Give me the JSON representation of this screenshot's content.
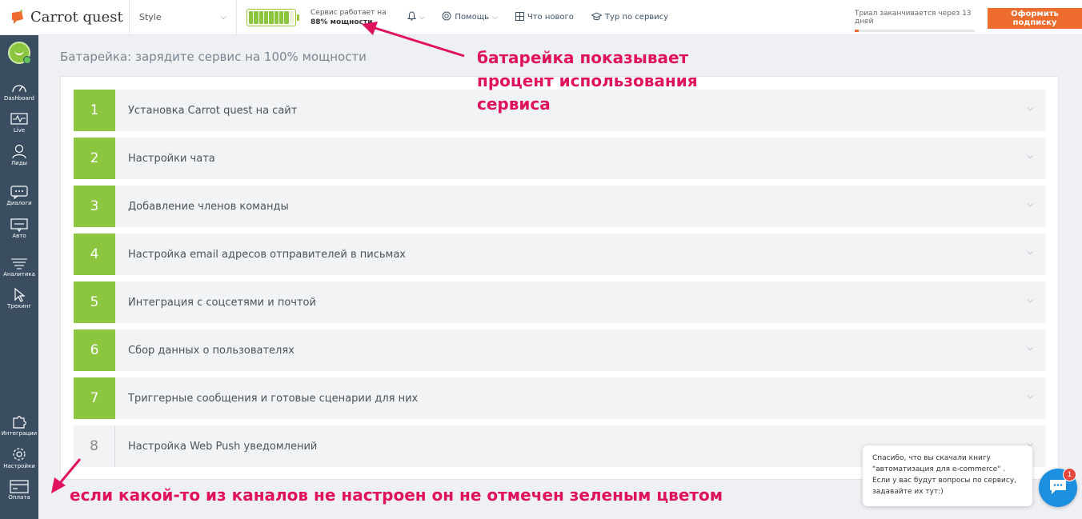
{
  "header": {
    "brand": "Carrot quest",
    "project": "Style",
    "battery": {
      "line1": "Сервис работает на",
      "line2": "88% мощности",
      "level_percent": 88,
      "cells_total": 9,
      "cells_filled": 8
    },
    "nav": [
      {
        "label": "",
        "icon": "bell-icon"
      },
      {
        "label": "Помощь",
        "icon": "lifebuoy-icon"
      },
      {
        "label": "Что нового",
        "icon": "grid-icon"
      },
      {
        "label": "Тур по сервису",
        "icon": "graduation-cap-icon"
      }
    ],
    "trial_text": "Триал заканчивается через 13 дней",
    "trial_progress_percent": 3,
    "subscribe_label": "Оформить подписку",
    "accent_color": "#ef6c2f"
  },
  "sidebar": {
    "items": [
      {
        "label": "Dashboard",
        "icon": "dashboard-icon"
      },
      {
        "label": "Live",
        "icon": "pulse-monitor-icon"
      },
      {
        "label": "Лиды",
        "icon": "users-icon"
      },
      {
        "label": "Диалоги",
        "icon": "dialogs-icon"
      },
      {
        "label": "Авто",
        "icon": "auto-message-icon"
      },
      {
        "label": "Аналитика",
        "icon": "analytics-icon"
      },
      {
        "label": "Трекинг",
        "icon": "cursor-icon"
      },
      {
        "label": "Интеграции",
        "icon": "puzzle-icon"
      },
      {
        "label": "Настройки",
        "icon": "gear-icon"
      },
      {
        "label": "Оплата",
        "icon": "credit-card-icon"
      }
    ]
  },
  "main": {
    "title": "Батарейка: зарядите сервис на 100% мощности",
    "steps": [
      {
        "num": "1",
        "title": "Установка Carrot quest на сайт",
        "done": true
      },
      {
        "num": "2",
        "title": "Настройки чата",
        "done": true
      },
      {
        "num": "3",
        "title": "Добавление членов команды",
        "done": true
      },
      {
        "num": "4",
        "title": "Настройка email адресов отправителей в письмах",
        "done": true
      },
      {
        "num": "5",
        "title": "Интеграция с соцсетями и почтой",
        "done": true
      },
      {
        "num": "6",
        "title": "Сбор данных о пользователях",
        "done": true
      },
      {
        "num": "7",
        "title": "Триггерные сообщения и готовые сценарии для них",
        "done": true
      },
      {
        "num": "8",
        "title": "Настройка Web Push уведомлений",
        "done": false
      }
    ],
    "done_color": "#8cc63f"
  },
  "annotations": {
    "battery_note": "батарейка показывает процент использования сервиса",
    "channels_note": "если какой-то из каналов не настроен он не отмечен зеленым цветом",
    "color": "#e0115f"
  },
  "chat": {
    "message": "Спасибо, что вы скачали книгу \"автоматизация для e-commerce\" . Если у вас будут вопросы по сервису, задавайте их тут:)",
    "unread": "1",
    "button_color": "#1d8fe0"
  }
}
